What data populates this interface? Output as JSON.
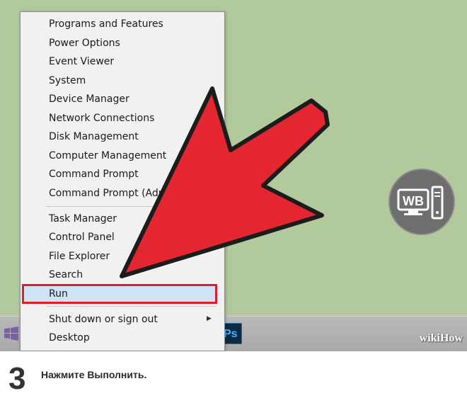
{
  "menu": {
    "group1": [
      "Programs and Features",
      "Power Options",
      "Event Viewer",
      "System",
      "Device Manager",
      "Network Connections",
      "Disk Management",
      "Computer Management",
      "Command Prompt",
      "Command Prompt (Adm"
    ],
    "group2": [
      "Task Manager",
      "Control Panel",
      "File Explorer",
      "Search",
      "Run"
    ],
    "group3": [
      "Shut down or sign out",
      "Desktop"
    ],
    "highlighted_item": "Run",
    "highlight_color": "#e11b2a",
    "submenu_arrow_icon": "chevron-right-icon"
  },
  "taskbar": {
    "ps_label": "Ps",
    "watermark": "wikiHow"
  },
  "logo": {
    "text": "WB"
  },
  "overlay": {
    "arrow_color": "#e3262f",
    "icon": "red-pointer-arrow"
  },
  "caption": {
    "step_number": "3",
    "text": "Нажмите Выполнить."
  }
}
